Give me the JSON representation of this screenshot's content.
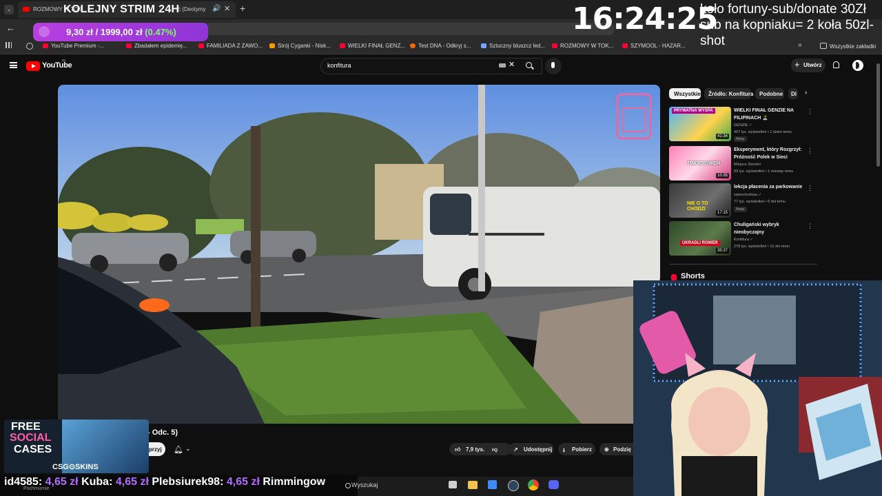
{
  "browser": {
    "tab_title": "ROZMOWY W TOK...",
    "tab_title_tail": "ć (Deotymy",
    "bookmarks": [
      "YouTube Premium -...",
      "Zbadałem epidemię...",
      "FAMILIADA Z ZAWO...",
      "Strój Cyganki - Nisk...",
      "WIELKI FINAŁ GENZ...",
      "Test DNA - Odkryj s...",
      "Sztuczny bluszcz led...",
      "ROZMOWY W TOK...",
      "SZYMOOL - HAZAR...",
      "Wszystkie zakładki"
    ]
  },
  "overlay": {
    "stream_title": "KOLEJNY STRIM 24H",
    "price": "9,30 zł / 1999,00 zł",
    "price_percent": "(0.47%)",
    "clock": "16:24:25",
    "promo_text": "koło fortuny-sub/donate 30Zł sub na kopniaku= 2 koła 50zl-shot",
    "ticker": [
      {
        "name": "id4585:",
        "amount": "4,65 zł"
      },
      {
        "name": "Kuba:",
        "amount": "4,65 zł"
      },
      {
        "name": "Plebsiurek98:",
        "amount": "4,65 zł"
      },
      {
        "name": "Rimmingow",
        "amount": ""
      }
    ],
    "csgo_promo": {
      "line1": "FREE",
      "line2": "SOCIAL",
      "line3": "CASES",
      "brand": "CSG⊙SKINS"
    }
  },
  "youtube": {
    "logo": "YouTube",
    "logo_region": "PL",
    "search_value": "konfitura",
    "create_label": "Utwórz",
    "video": {
      "title_fragment": "- Odc. 5)",
      "subscribe_fragment": "przyj",
      "likes": "7,9 tys.",
      "share_label": "Udostępnij",
      "download_label": "Pobierz",
      "more_label": "Podzię"
    },
    "chips": [
      "Wszystkie",
      "Źródło: Konfitura",
      "Podobne",
      "Di"
    ],
    "recommendations": [
      {
        "title": "WIELKI FINAŁ GENZIE NA FILIPINACH 🏝️",
        "channel": "GENZIE ✓",
        "meta": "467 tys. wyświetleń • 1 dzień temu",
        "badge": "Nowy",
        "duration": "41:34",
        "thumb_label": "PRYWATNA WYSPA"
      },
      {
        "title": "Eksperyment, który Rozgrzył: Próżność Polek w Sieci",
        "channel": "Miejsce Zbrodni",
        "meta": "93 tys. wyświetleń • 1 miesiąc temu",
        "badge": "",
        "duration": "10:35",
        "thumb_label": "TINDEROWEH"
      },
      {
        "title": "lekcja płacenia za parkowanie",
        "channel": "samochodoza ✓",
        "meta": "77 tys. wyświetleń • 6 dni temu",
        "badge": "Nowy",
        "duration": "17:15",
        "thumb_label": "NIE O TO CHODZI"
      },
      {
        "title": "Chuligański wybryk nieobyczajny",
        "channel": "Konfitura ✓",
        "meta": "278 tys. wyświetleń • 12 dni temu",
        "badge": "",
        "duration": "35:37",
        "thumb_label": "UKRADLI ROWER"
      }
    ],
    "shorts_label": "Shorts"
  },
  "taskbar": {
    "search_placeholder": "Wyszukaj",
    "weather": "Pochmurnie"
  },
  "colors": {
    "yt_red": "#ff0000",
    "price_green": "#7dff62",
    "donation_purple": "#b36cff",
    "pill_purple": "#a83be0"
  }
}
